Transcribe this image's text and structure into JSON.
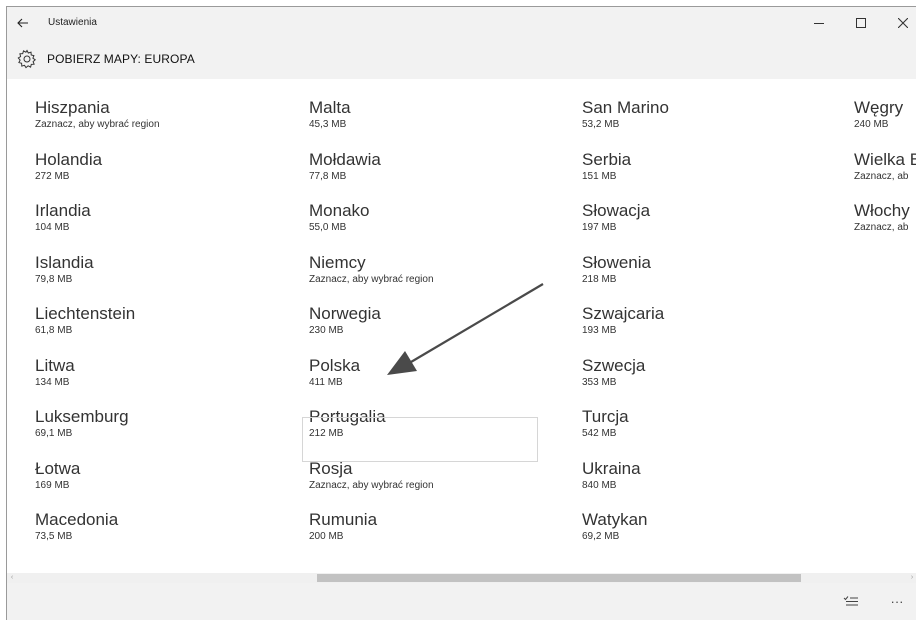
{
  "window": {
    "title": "Ustawienia"
  },
  "header": {
    "title": "POBIERZ MAPY: EUROPA",
    "icon": "gear-icon"
  },
  "columns": [
    [
      {
        "name": "Hiszpania",
        "size": "Zaznacz, aby wybrać region"
      },
      {
        "name": "Holandia",
        "size": "272 MB"
      },
      {
        "name": "Irlandia",
        "size": "104 MB"
      },
      {
        "name": "Islandia",
        "size": "79,8 MB"
      },
      {
        "name": "Liechtenstein",
        "size": "61,8 MB"
      },
      {
        "name": "Litwa",
        "size": "134 MB"
      },
      {
        "name": "Luksemburg",
        "size": "69,1 MB"
      },
      {
        "name": "Łotwa",
        "size": "169 MB"
      },
      {
        "name": "Macedonia",
        "size": "73,5 MB"
      }
    ],
    [
      {
        "name": "Malta",
        "size": "45,3 MB"
      },
      {
        "name": "Mołdawia",
        "size": "77,8 MB"
      },
      {
        "name": "Monako",
        "size": "55,0 MB"
      },
      {
        "name": "Niemcy",
        "size": "Zaznacz, aby wybrać region"
      },
      {
        "name": "Norwegia",
        "size": "230 MB"
      },
      {
        "name": "Polska",
        "size": "411 MB"
      },
      {
        "name": "Portugalia",
        "size": "212 MB"
      },
      {
        "name": "Rosja",
        "size": "Zaznacz, aby wybrać region"
      },
      {
        "name": "Rumunia",
        "size": "200 MB"
      }
    ],
    [
      {
        "name": "San Marino",
        "size": "53,2 MB"
      },
      {
        "name": "Serbia",
        "size": "151 MB"
      },
      {
        "name": "Słowacja",
        "size": "197 MB"
      },
      {
        "name": "Słowenia",
        "size": "218 MB"
      },
      {
        "name": "Szwajcaria",
        "size": "193 MB"
      },
      {
        "name": "Szwecja",
        "size": "353 MB"
      },
      {
        "name": "Turcja",
        "size": "542 MB"
      },
      {
        "name": "Ukraina",
        "size": "840 MB"
      },
      {
        "name": "Watykan",
        "size": "69,2 MB"
      }
    ],
    [
      {
        "name": "Węgry",
        "size": "240 MB"
      },
      {
        "name": "Wielka B",
        "size": "Zaznacz, ab"
      },
      {
        "name": "Włochy",
        "size": "Zaznacz, ab"
      }
    ]
  ],
  "colors": {
    "chrome": "#f2f2f2",
    "text": "#333333",
    "scroll_thumb": "#c2c2c2"
  }
}
